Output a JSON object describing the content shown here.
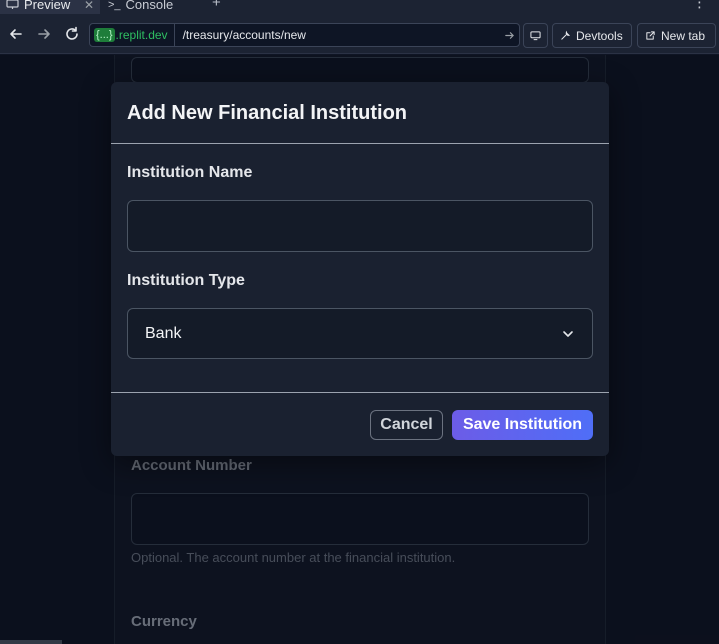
{
  "browser": {
    "tabs": [
      {
        "label": "Preview",
        "active": true
      },
      {
        "label": "Console",
        "active": false
      }
    ],
    "url_badge": "{...}",
    "url_domain": ".replit.dev",
    "url_path": "/treasury/accounts/new",
    "devtools_label": "Devtools",
    "new_tab_label": "New tab"
  },
  "background_form": {
    "account_number_label": "Account Number",
    "account_number_help": "Optional. The account number at the financial institution.",
    "currency_label": "Currency"
  },
  "modal": {
    "title": "Add New Financial Institution",
    "name_label": "Institution Name",
    "name_value": "",
    "type_label": "Institution Type",
    "type_value": "Bank",
    "cancel_label": "Cancel",
    "save_label": "Save Institution"
  },
  "colors": {
    "background": "#0f1524",
    "modal": "#1a2130",
    "accent_start": "#6c5ce7",
    "accent_end": "#4f6ef7"
  }
}
